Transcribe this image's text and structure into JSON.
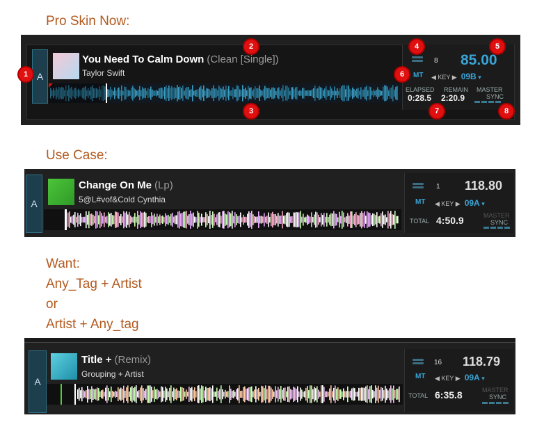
{
  "sections": [
    {
      "heading": "Pro Skin Now:"
    },
    {
      "heading": "Use Case:"
    },
    {
      "heading_lines": [
        "Want:",
        "Any_Tag + Artist",
        "or",
        "Artist + Any_tag"
      ]
    }
  ],
  "decks": [
    {
      "deck_letter": "A",
      "title": "You Need To Calm Down",
      "title_suffix": "(Clean [Single])",
      "artist": "Taylor Swift",
      "loop_count": "8",
      "bpm": "85.00",
      "mt_label": "MT",
      "key_label": "KEY",
      "key_value": "09B",
      "elapsed_label": "ELAPSED",
      "elapsed_value": "0:28.5",
      "remain_label": "REMAIN",
      "remain_value": "2:20.9",
      "master_label": "MASTER",
      "sync_label": "SYNC",
      "markers": [
        "1",
        "2",
        "3",
        "4",
        "5",
        "6",
        "7",
        "8"
      ],
      "colors": {
        "bpm": "#3aa4d6",
        "waveform": "#2d86a8",
        "art": "#e6b3c2"
      }
    },
    {
      "deck_letter": "A",
      "title": "Change On Me",
      "title_suffix": "(Lp)",
      "artist": "5@L#vof&Cold Cynthia",
      "loop_count": "1",
      "bpm": "118.80",
      "mt_label": "MT",
      "key_label": "KEY",
      "key_value": "09A",
      "total_label": "TOTAL",
      "total_value": "4:50.9",
      "master_label": "MASTER",
      "sync_label": "SYNC",
      "colors": {
        "bpm": "#dddddd",
        "waveform_a": "#e8a8ff",
        "waveform_b": "#c8ffb0",
        "art": "#4cc43a"
      }
    },
    {
      "deck_letter": "A",
      "title": "Title +",
      "title_suffix": "(Remix)",
      "artist": "Grouping + Artist",
      "loop_count": "16",
      "bpm": "118.79",
      "mt_label": "MT",
      "key_label": "KEY",
      "key_value": "09A",
      "total_label": "TOTAL",
      "total_value": "6:35.8",
      "master_label": "MASTER",
      "sync_label": "SYNC",
      "colors": {
        "bpm": "#dddddd",
        "waveform_a": "#f0c0f0",
        "waveform_b": "#c8ffb0",
        "art": "#3ab8d0"
      }
    }
  ]
}
